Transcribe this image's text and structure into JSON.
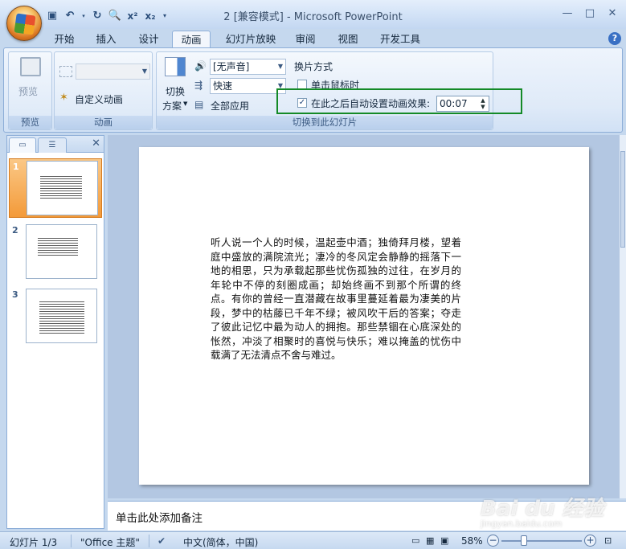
{
  "window": {
    "title": "2 [兼容模式] - Microsoft PowerPoint",
    "buttons": {
      "minimize": "—",
      "maximize": "□",
      "close": "✕"
    }
  },
  "quick_access": {
    "icons": [
      "save-icon",
      "undo-icon",
      "redo-icon",
      "print-preview-icon",
      "superscript-icon",
      "subscript-icon",
      "customize-icon"
    ],
    "superscript": "x²",
    "subscript": "x₂"
  },
  "tabs": [
    "开始",
    "插入",
    "设计",
    "动画",
    "幻灯片放映",
    "审阅",
    "视图",
    "开发工具"
  ],
  "active_tab": "动画",
  "ribbon": {
    "preview_group": {
      "button_label": "预览",
      "group_label": "预览"
    },
    "animation_group": {
      "effect_combo": "",
      "custom_animation": "自定义动画",
      "group_label": "动画"
    },
    "transition_group": {
      "scheme_label_line1": "切换",
      "scheme_label_line2": "方案",
      "sound_combo": "[无声音]",
      "speed_combo": "快速",
      "apply_all": "全部应用",
      "advance_heading": "换片方式",
      "on_click_label": "单击鼠标时",
      "on_click_checked": false,
      "auto_after_label": "在此之后自动设置动画效果:",
      "auto_after_checked": true,
      "auto_after_time": "00:07",
      "group_label": "切换到此幻灯片"
    }
  },
  "slides_panel": {
    "slides": [
      {
        "number": "1",
        "selected": true
      },
      {
        "number": "2",
        "selected": false
      },
      {
        "number": "3",
        "selected": false
      }
    ]
  },
  "slide": {
    "text": "听人说一个人的时候，温起壶中酒；独倚拜月楼，望着庭中盛放的满院流光；凄冷的冬风定会静静的摇落下一地的相思，只为承载起那些忧伤孤独的过往，在岁月的年轮中不停的刻圈成画；却始终画不到那个所谓的终点。有你的曾经一直潜藏在故事里蔓延着最为凄美的片段，梦中的枯藤已千年不绿；被风吹干后的答案；夺走了彼此记忆中最为动人的拥抱。那些禁锢在心底深处的怅然，冲淡了相聚时的喜悦与快乐；难以掩盖的忧伤中载满了无法清点不舍与难过。"
  },
  "notes": {
    "placeholder": "单击此处添加备注"
  },
  "status_bar": {
    "slide_info": "幻灯片 1/3",
    "theme": "\"Office 主题\"",
    "language": "中文(简体，中国)",
    "zoom": "58%"
  },
  "watermark": {
    "brand": "Bai du 经验",
    "url": "jingyan.baidu.com"
  }
}
